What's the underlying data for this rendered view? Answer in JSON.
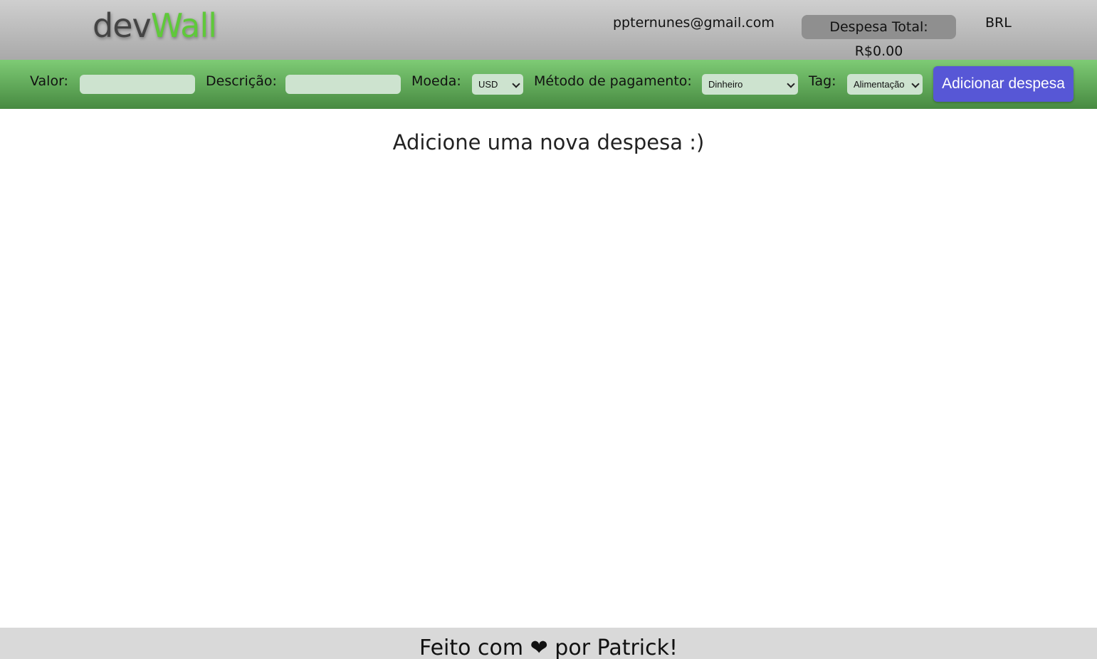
{
  "header": {
    "logo_dev": "dev",
    "logo_wall": "Wall",
    "email": "ppternunes@gmail.com",
    "total": "Despesa Total: R$0.00",
    "currency": "BRL"
  },
  "form": {
    "value_label": "Valor:",
    "value_input": "",
    "description_label": "Descrição:",
    "description_input": "",
    "currency_label": "Moeda:",
    "currency_selected": "USD",
    "method_label": "Método de pagamento:",
    "method_selected": "Dinheiro",
    "tag_label": "Tag:",
    "tag_selected": "Alimentação",
    "add_button": "Adicionar despesa"
  },
  "main": {
    "empty_message": "Adicione uma nova despesa :)"
  },
  "footer": {
    "text": "Feito com ❤ por Patrick!"
  },
  "colors": {
    "accent_green": "#5fc93a",
    "button_blue": "#5757d6",
    "input_bg": "#cde3cf"
  }
}
